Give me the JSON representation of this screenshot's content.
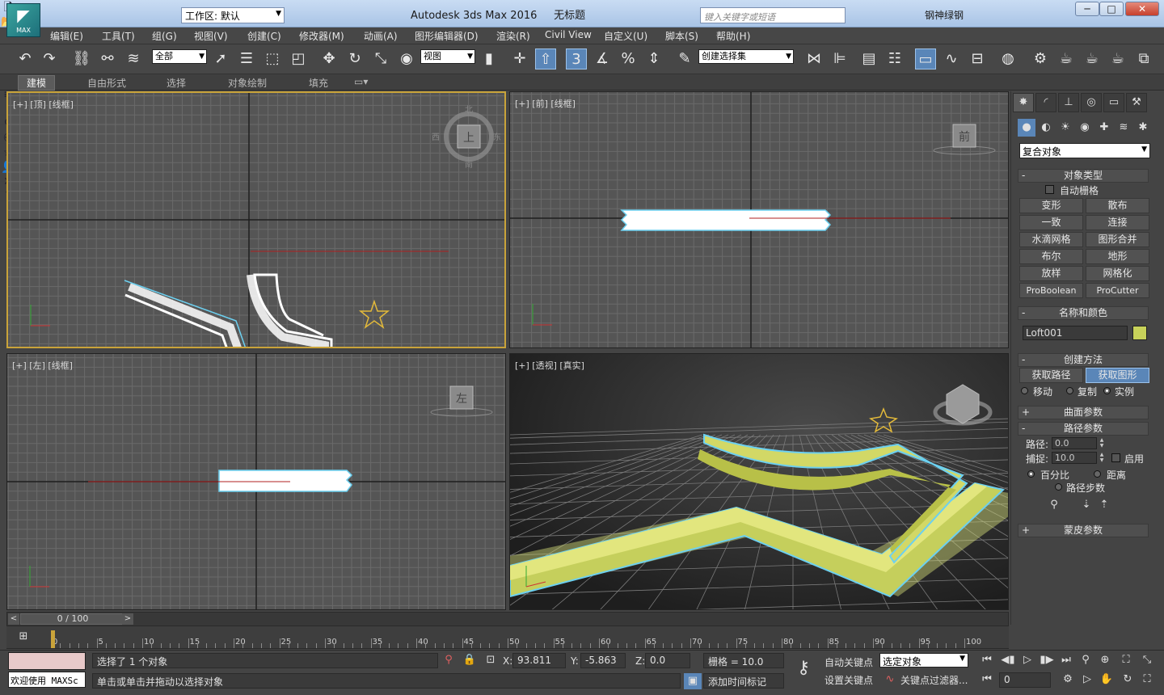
{
  "titlebar": {
    "app_title": "Autodesk 3ds Max 2016",
    "doc_title": "无标题",
    "workspace": "工作区: 默认",
    "search_placeholder": "键入关键字或短语",
    "user_name": "钢神绿钢",
    "logo_text": "MAX"
  },
  "menu": [
    "编辑(E)",
    "工具(T)",
    "组(G)",
    "视图(V)",
    "创建(C)",
    "修改器(M)",
    "动画(A)",
    "图形编辑器(D)",
    "渲染(R)",
    "Civil View",
    "自定义(U)",
    "脚本(S)",
    "帮助(H)"
  ],
  "toolbar": {
    "selection_filter": "全部",
    "ref_coord": "视图",
    "named_sel": "创建选择集"
  },
  "ribbon_tabs": [
    "建模",
    "自由形式",
    "选择",
    "对象绘制",
    "填充"
  ],
  "viewports": {
    "top": "[+] [顶] [线框]",
    "front": "[+] [前] [线框]",
    "left": "[+] [左] [线框]",
    "persp": "[+] [透视] [真实]",
    "viewcube_top": "上",
    "viewcube_front": "前",
    "viewcube_left": "左",
    "compass_n": "北",
    "compass_s": "南",
    "compass_e": "东",
    "compass_w": "西"
  },
  "command_panel": {
    "category": "复合对象",
    "object_type": {
      "title": "对象类型",
      "autogrid": "自动栅格",
      "buttons": [
        "变形",
        "散布",
        "一致",
        "连接",
        "水滴网格",
        "图形合并",
        "布尔",
        "地形",
        "放样",
        "网格化",
        "ProBoolean",
        "ProCutter"
      ]
    },
    "name_color": {
      "title": "名称和颜色",
      "name": "Loft001",
      "color": "#c8d25a"
    },
    "creation_method": {
      "title": "创建方法",
      "get_path": "获取路径",
      "get_shape": "获取图形",
      "move": "移动",
      "copy": "复制",
      "instance": "实例"
    },
    "surface_params": "曲面参数",
    "path_params": {
      "title": "路径参数",
      "path_label": "路径:",
      "path_value": "0.0",
      "snap_label": "捕捉:",
      "snap_value": "10.0",
      "enable": "启用",
      "percent": "百分比",
      "distance": "距离",
      "path_steps": "路径步数"
    },
    "skin_params": "蒙皮参数"
  },
  "timeline": {
    "position": "0 / 100",
    "ticks": [
      "0",
      "5",
      "10",
      "15",
      "20",
      "25",
      "30",
      "35",
      "40",
      "45",
      "50",
      "55",
      "60",
      "65",
      "70",
      "75",
      "80",
      "85",
      "90",
      "95",
      "100"
    ]
  },
  "status": {
    "maxscript": "欢迎使用 MAXSc",
    "selected": "选择了 1 个对象",
    "prompt": "单击或单击并拖动以选择对象",
    "x_label": "X:",
    "x": "93.811",
    "y_label": "Y:",
    "y": "-5.863",
    "z_label": "Z:",
    "z": "0.0",
    "grid": "栅格 = 10.0",
    "add_time_tag": "添加时间标记",
    "auto_key": "自动关键点",
    "set_key": "设置关键点",
    "key_mode": "选定对象",
    "key_filters": "关键点过滤器...",
    "frame": "0"
  }
}
